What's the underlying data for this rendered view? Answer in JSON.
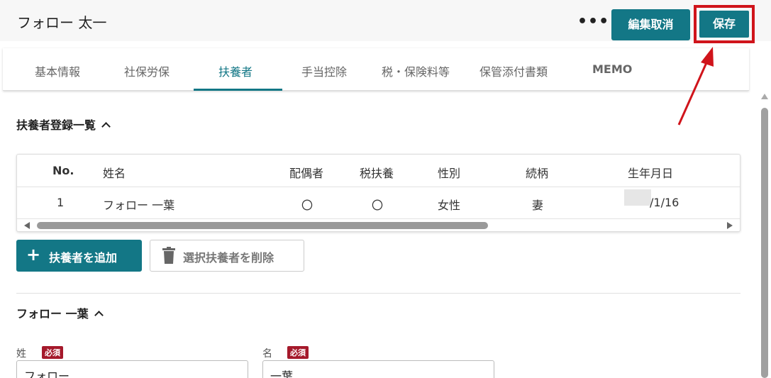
{
  "header": {
    "title": "フォロー 太一",
    "more_label": "•••",
    "cancel_label": "編集取消",
    "save_label": "保存"
  },
  "tabs": [
    {
      "label": "基本情報"
    },
    {
      "label": "社保労保"
    },
    {
      "label": "扶養者",
      "active": true
    },
    {
      "label": "手当控除"
    },
    {
      "label": "税・保険料等"
    },
    {
      "label": "保管添付書類"
    },
    {
      "label": "MEMO"
    }
  ],
  "dependents_section": {
    "title": "扶養者登録一覧",
    "columns": [
      "No.",
      "姓名",
      "配偶者",
      "税扶養",
      "性別",
      "続柄",
      "生年月日"
    ],
    "rows": [
      {
        "no": "1",
        "name": "フォロー 一葉",
        "spouse": "〇",
        "tax_dependent": "〇",
        "gender": "女性",
        "relation": "妻",
        "birthdate": "/1/16"
      }
    ],
    "add_button": "扶養者を追加",
    "delete_button": "選択扶養者を削除"
  },
  "detail_section": {
    "title": "フォロー 一葉",
    "last_name_label": "姓",
    "first_name_label": "名",
    "required_badge": "必須",
    "last_name_value": "フォロー",
    "first_name_value": "一葉"
  },
  "colors": {
    "accent": "#137786",
    "highlight": "#d0141b",
    "required": "#a5192b"
  }
}
